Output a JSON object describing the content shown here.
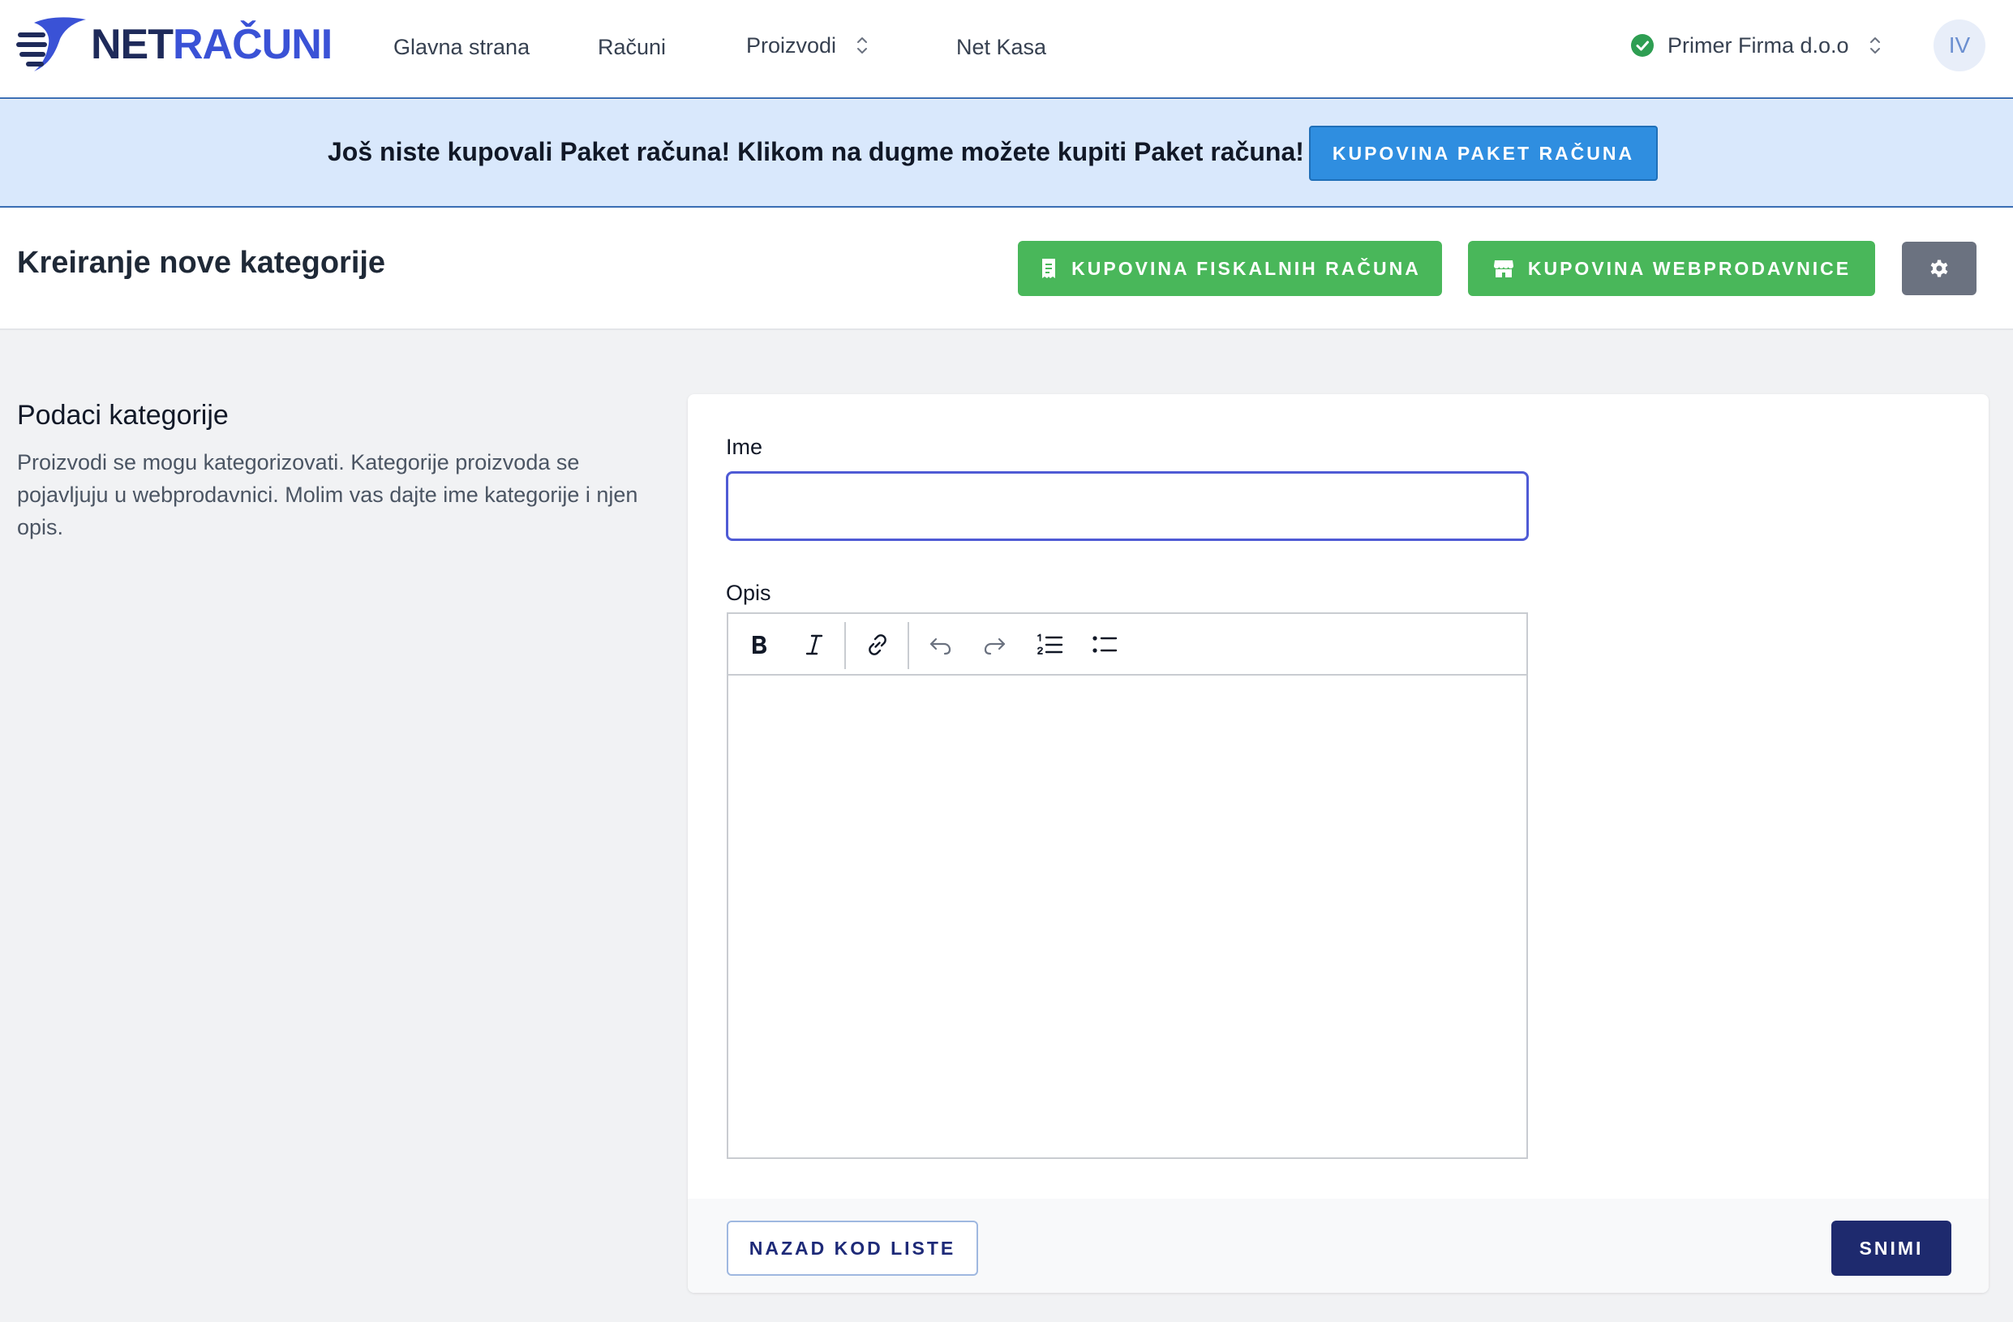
{
  "nav": {
    "logo": {
      "part1": "NET",
      "part2": "RAČUNI"
    },
    "items": [
      {
        "label": "Glavna strana"
      },
      {
        "label": "Računi"
      },
      {
        "label": "Proizvodi"
      },
      {
        "label": "Net Kasa"
      }
    ],
    "company": "Primer Firma d.o.o",
    "avatar_initials": "IV"
  },
  "banner": {
    "text": "Još niste kupovali Paket računa! Klikom na dugme možete kupiti Paket računa!",
    "button": "KUPOVINA PAKET RAČUNA"
  },
  "header": {
    "title": "Kreiranje nove kategorije",
    "buy_fiscal_label": "KUPOVINA FISKALNIH RAČUNA",
    "buy_webshop_label": "KUPOVINA WEBPRODAVNICE"
  },
  "section": {
    "title": "Podaci kategorije",
    "description": "Proizvodi se mogu kategorizovati. Kategorije proizvoda se pojavljuju u webprodavnici. Molim vas dajte ime kategorije i njen opis."
  },
  "form": {
    "name_label": "Ime",
    "name_value": "",
    "description_label": "Opis",
    "description_value": "",
    "back_label": "NAZAD KOD LISTE",
    "save_label": "SNIMI"
  },
  "colors": {
    "primary_blue": "#2f8ee0",
    "banner_bg": "#d9e8fc",
    "green": "#49b75a",
    "navy": "#1e2a6e",
    "input_focus": "#4f5bd5",
    "logo_accent": "#3a52d6"
  },
  "icons": {
    "toolbar": [
      "bold-icon",
      "italic-icon",
      "link-icon",
      "undo-icon",
      "redo-icon",
      "ordered-list-icon",
      "bullet-list-icon"
    ]
  }
}
